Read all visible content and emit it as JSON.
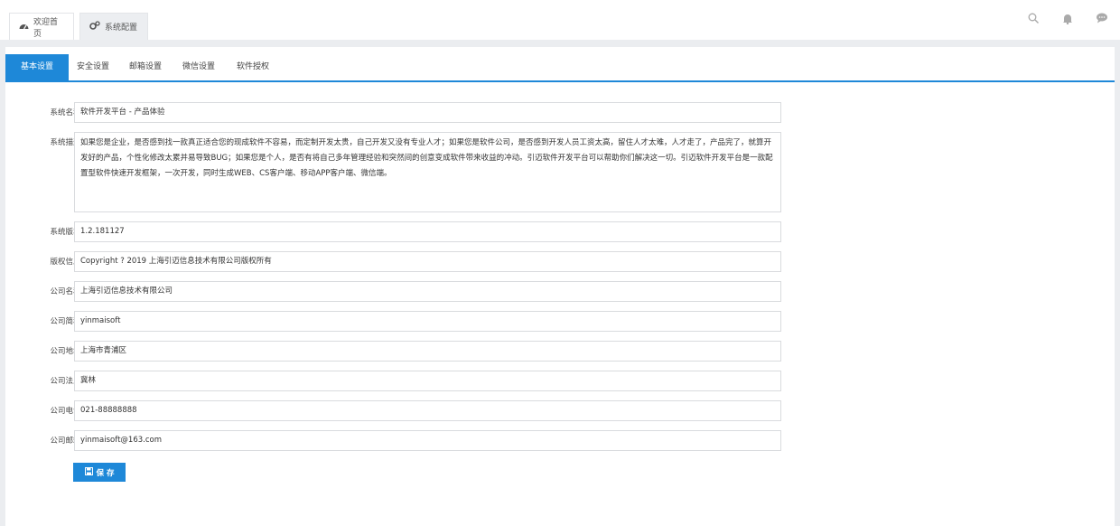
{
  "header": {
    "tabs": [
      {
        "label": "欢迎首页",
        "icon": "dashboard-icon"
      },
      {
        "label": "系统配置",
        "icon": "gears-icon"
      }
    ],
    "icons": [
      "search-icon",
      "bell-icon",
      "chat-icon"
    ]
  },
  "settings": {
    "tabs": [
      "基本设置",
      "安全设置",
      "邮箱设置",
      "微信设置",
      "软件授权"
    ],
    "active_tab": "基本设置",
    "fields": [
      {
        "label": "系统名称：",
        "value": "软件开发平台 - 产品体验"
      },
      {
        "label": "系统描述：",
        "value": "如果您是企业，是否感到找一款真正适合您的现成软件不容易，而定制开发太贵，自己开发又没有专业人才；如果您是软件公司，是否感到开发人员工资太高，留住人才太难，人才走了，产品完了，就算开发好的产品，个性化修改太累并易导致BUG；如果您是个人，是否有将自己多年管理经验和突然间的创意变成软件带来收益的冲动。引迈软件开发平台可以帮助你们解决这一切。引迈软件开发平台是一款配置型软件快速开发框架，一次开发，同时生成WEB、CS客户端、移动APP客户端、微信端。"
      },
      {
        "label": "系统版本：",
        "value": "1.2.181127"
      },
      {
        "label": "版权信息：",
        "value": "Copyright ? 2019  上海引迈信息技术有限公司版权所有"
      },
      {
        "label": "公司名称：",
        "value": "上海引迈信息技术有限公司"
      },
      {
        "label": "公司简称：",
        "value": "yinmaisoft"
      },
      {
        "label": "公司地址：",
        "value": "上海市青浦区"
      },
      {
        "label": "公司法人：",
        "value": "冀林"
      },
      {
        "label": "公司电话：",
        "value": "021-88888888"
      },
      {
        "label": "公司邮箱：",
        "value": "yinmaisoft@163.com"
      }
    ],
    "save_label": "保 存",
    "colors": {
      "accent": "#1e88d8"
    }
  }
}
